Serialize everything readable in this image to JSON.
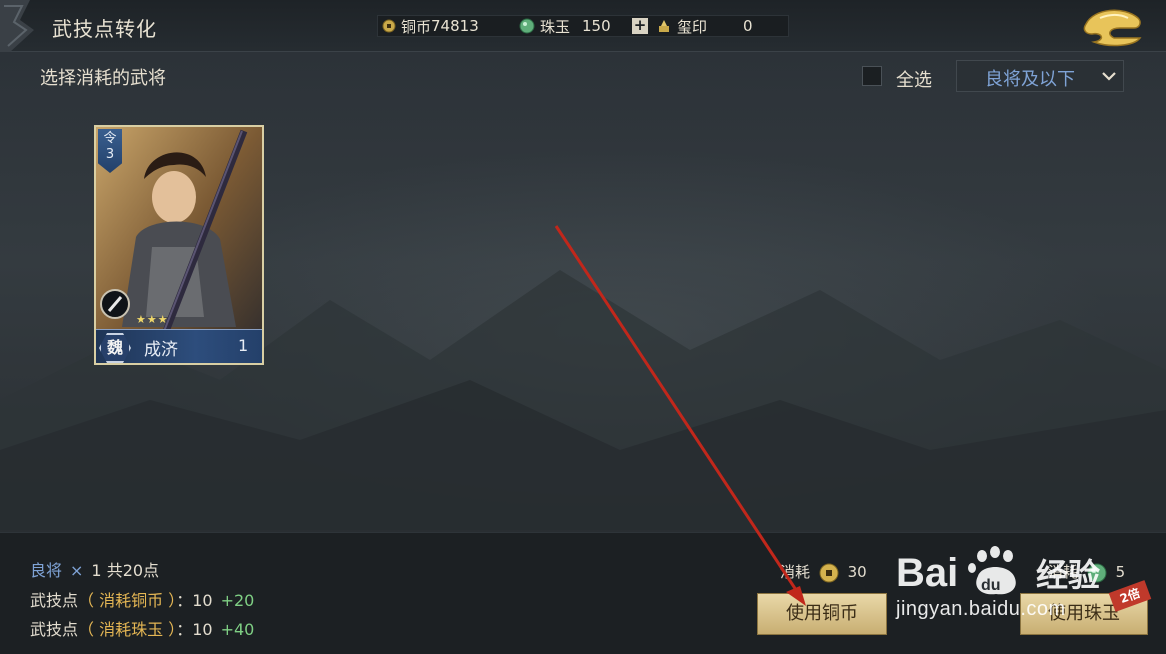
{
  "header": {
    "title": "武技点转化",
    "currencies": {
      "copper": {
        "icon": "copper-coin-icon",
        "label": "铜币",
        "value": "74813"
      },
      "jade": {
        "icon": "jade-icon",
        "label": "珠玉",
        "value": "150"
      },
      "add_label": "+",
      "seal": {
        "icon": "seal-icon",
        "label": "玺印",
        "value": "0"
      }
    }
  },
  "selection": {
    "label": "选择消耗的武将",
    "select_all_label": "全选",
    "filter_value": "良将及以下"
  },
  "cards": [
    {
      "rank_label": "令",
      "rank_value": "3",
      "faction": "魏",
      "name": "成济",
      "count": "1",
      "stars": "★★★"
    }
  ],
  "summary": {
    "grade": "良将",
    "times": "×",
    "count_text": "1 共20点",
    "line1": {
      "prefix": "武技点",
      "paren": "（ 消耗铜币 ）",
      "value": "：10",
      "bonus": "+20"
    },
    "line2": {
      "prefix": "武技点",
      "paren": "（ 消耗珠玉 ）",
      "value": "：10",
      "bonus": "+40"
    }
  },
  "actions": {
    "copper_cost_label": "消耗",
    "copper_cost_value": "30",
    "jade_cost_label": "消耗",
    "jade_cost_value": "5",
    "use_copper_label": "使用铜币",
    "use_jade_label": "使用珠玉",
    "double_tag": "2倍"
  },
  "watermark": {
    "logo_text": "Bai du 经验",
    "url": "jingyan.baidu.com"
  },
  "colors": {
    "accent_blue": "#7fa3d6",
    "accent_gold": "#e4b654",
    "bonus_green": "#7fcf84",
    "annotation_red": "#c1271b"
  }
}
